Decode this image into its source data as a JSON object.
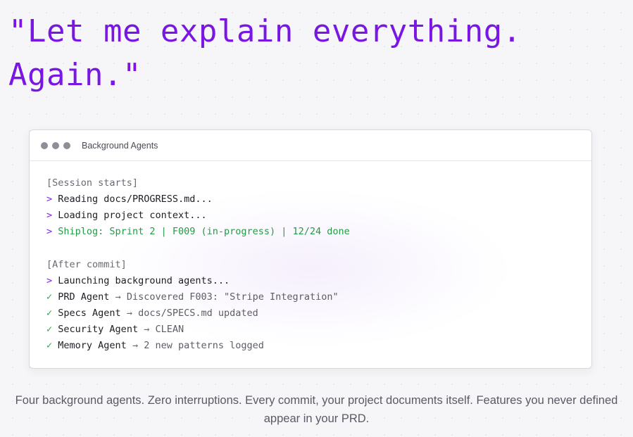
{
  "headline": {
    "line1": "\"Let me explain everything.",
    "line2": "Again.\""
  },
  "window": {
    "title": "Background Agents",
    "controls": [
      "dot",
      "dot",
      "dot"
    ]
  },
  "terminal": {
    "session_start": "[Session starts]",
    "prompt_symbol": ">",
    "check_symbol": "✓",
    "arrow_symbol": "→",
    "reading": "Reading docs/PROGRESS.md...",
    "loading": "Loading project context...",
    "shiplog": "Shiplog: Sprint 2 | F009 (in-progress) | 12/24 done",
    "after_commit": "[After commit]",
    "launching": "Launching background agents...",
    "agents": [
      {
        "name": "PRD Agent",
        "detail": "Discovered F003: \"Stripe Integration\""
      },
      {
        "name": "Specs Agent",
        "detail": "docs/SPECS.md updated"
      },
      {
        "name": "Security Agent",
        "detail": "CLEAN"
      },
      {
        "name": "Memory Agent",
        "detail": "2 new patterns logged"
      }
    ]
  },
  "caption": "Four background agents. Zero interruptions. Every commit, your project documents itself. Features you never defined appear in your PRD.",
  "colors": {
    "accent_purple": "#7a16e3",
    "success_green": "#239b45",
    "background": "#f6f6f8"
  }
}
